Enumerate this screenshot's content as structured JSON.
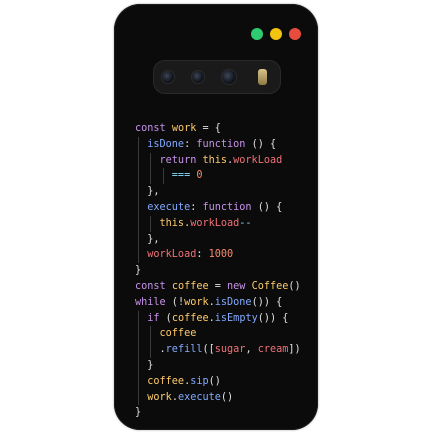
{
  "colors": {
    "background": "#ffffff",
    "case": "#0b0b0b",
    "keyword": "#c792ea",
    "identifier": "#ffcb6b",
    "property": "#82aaff",
    "punctuation": "#e0e0e0",
    "this": "#ffcb6b",
    "member": "#f07178",
    "number": "#f78c6c",
    "operator": "#89ddff",
    "function_name": "#82aaff",
    "string_like": "#f07178",
    "window_green": "#2ecc71",
    "window_yellow": "#f1c40f",
    "window_red": "#e74c3c"
  },
  "code_lines": [
    [
      {
        "t": "const ",
        "c": "keyword"
      },
      {
        "t": "work",
        "c": "identifier"
      },
      {
        "t": " = {",
        "c": "punctuation"
      }
    ],
    [
      {
        "t": "  isDone",
        "c": "property"
      },
      {
        "t": ": ",
        "c": "punctuation"
      },
      {
        "t": "function",
        "c": "keyword"
      },
      {
        "t": " () {",
        "c": "punctuation"
      }
    ],
    [
      {
        "t": "    return ",
        "c": "keyword"
      },
      {
        "t": "this",
        "c": "this"
      },
      {
        "t": ".",
        "c": "punctuation"
      },
      {
        "t": "workLoad",
        "c": "member"
      }
    ],
    [
      {
        "t": "      === ",
        "c": "operator"
      },
      {
        "t": "0",
        "c": "number"
      }
    ],
    [
      {
        "t": "  },",
        "c": "punctuation"
      }
    ],
    [
      {
        "t": "  execute",
        "c": "property"
      },
      {
        "t": ": ",
        "c": "punctuation"
      },
      {
        "t": "function",
        "c": "keyword"
      },
      {
        "t": " () {",
        "c": "punctuation"
      }
    ],
    [
      {
        "t": "    this",
        "c": "this"
      },
      {
        "t": ".",
        "c": "punctuation"
      },
      {
        "t": "workLoad",
        "c": "member"
      },
      {
        "t": "--",
        "c": "operator"
      }
    ],
    [
      {
        "t": "  },",
        "c": "punctuation"
      }
    ],
    [
      {
        "t": "  workLoad",
        "c": "member"
      },
      {
        "t": ": ",
        "c": "punctuation"
      },
      {
        "t": "1000",
        "c": "number"
      }
    ],
    [
      {
        "t": "}",
        "c": "punctuation"
      }
    ],
    [
      {
        "t": "const ",
        "c": "keyword"
      },
      {
        "t": "coffee",
        "c": "identifier"
      },
      {
        "t": " = ",
        "c": "punctuation"
      },
      {
        "t": "new ",
        "c": "keyword"
      },
      {
        "t": "Coffee",
        "c": "identifier"
      },
      {
        "t": "()",
        "c": "punctuation"
      }
    ],
    [
      {
        "t": "while",
        "c": "keyword"
      },
      {
        "t": " (!",
        "c": "punctuation"
      },
      {
        "t": "work",
        "c": "identifier"
      },
      {
        "t": ".",
        "c": "punctuation"
      },
      {
        "t": "isDone",
        "c": "function_name"
      },
      {
        "t": "()) {",
        "c": "punctuation"
      }
    ],
    [
      {
        "t": "  if",
        "c": "keyword"
      },
      {
        "t": " (",
        "c": "punctuation"
      },
      {
        "t": "coffee",
        "c": "identifier"
      },
      {
        "t": ".",
        "c": "punctuation"
      },
      {
        "t": "isEmpty",
        "c": "function_name"
      },
      {
        "t": "()) {",
        "c": "punctuation"
      }
    ],
    [
      {
        "t": "    coffee",
        "c": "identifier"
      }
    ],
    [
      {
        "t": "    .",
        "c": "punctuation"
      },
      {
        "t": "refill",
        "c": "function_name"
      },
      {
        "t": "([",
        "c": "punctuation"
      },
      {
        "t": "sugar",
        "c": "string_like"
      },
      {
        "t": ", ",
        "c": "punctuation"
      },
      {
        "t": "cream",
        "c": "string_like"
      },
      {
        "t": "])",
        "c": "punctuation"
      }
    ],
    [
      {
        "t": "  }",
        "c": "punctuation"
      }
    ],
    [
      {
        "t": "  coffee",
        "c": "identifier"
      },
      {
        "t": ".",
        "c": "punctuation"
      },
      {
        "t": "sip",
        "c": "function_name"
      },
      {
        "t": "()",
        "c": "punctuation"
      }
    ],
    [
      {
        "t": "  work",
        "c": "identifier"
      },
      {
        "t": ".",
        "c": "punctuation"
      },
      {
        "t": "execute",
        "c": "function_name"
      },
      {
        "t": "()",
        "c": "punctuation"
      }
    ],
    [
      {
        "t": "}",
        "c": "punctuation"
      }
    ]
  ]
}
